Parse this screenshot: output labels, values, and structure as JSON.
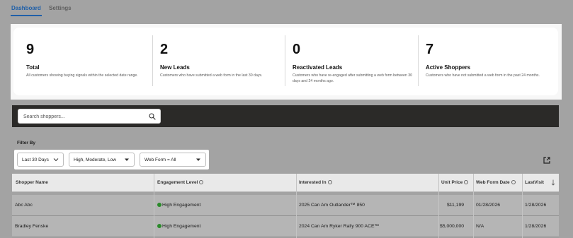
{
  "tabs": [
    {
      "label": "Dashboard",
      "active": true
    },
    {
      "label": "Settings",
      "active": false
    }
  ],
  "summary_cards": [
    {
      "value": "9",
      "label": "Total",
      "description": "All customers showing buying signals within the selected date range."
    },
    {
      "value": "2",
      "label": "New Leads",
      "description": "Customers who have submitted a web form in the last 30 days."
    },
    {
      "value": "0",
      "label": "Reactivated Leads",
      "description": "Customers who have re-engaged after submitting a web form between 30 days and 24 months ago."
    },
    {
      "value": "7",
      "label": "Active Shoppers",
      "description": "Customers who have not submitted a web form in the past 24 months."
    }
  ],
  "search": {
    "placeholder": "Search shoppers..."
  },
  "filters": {
    "title": "Filter By",
    "date_range": "Last 30 Days",
    "engagement": "High, Moderate, Low",
    "web_form": "Web Form = All"
  },
  "table": {
    "headers": {
      "shopper_name": "Shopper Name",
      "engagement_level": "Engagement Level",
      "interested_in": "Interested In",
      "unit_price": "Unit Price",
      "web_form_date": "Web Form Date",
      "last_visit": "LastVisit"
    },
    "rows": [
      {
        "shopper_name": "Abc Abc",
        "engagement_level": "High Engagement",
        "interested_in": "2025 Can Am Outlander™ 850",
        "unit_price": "$11,199",
        "web_form_date": "01/28/2026",
        "last_visit": "1/28/2026"
      },
      {
        "shopper_name": "Bradley Fenske",
        "engagement_level": "High Engagement",
        "interested_in": "2024 Can Am Ryker Rally 900 ACE™",
        "unit_price": "$5,000,000",
        "web_form_date": "N/A",
        "last_visit": "1/28/2026"
      }
    ]
  },
  "colors": {
    "accent": "#1f5fa8",
    "high_engagement_dot": "#2a8a2a",
    "search_bar_bg": "#2b2a28"
  }
}
